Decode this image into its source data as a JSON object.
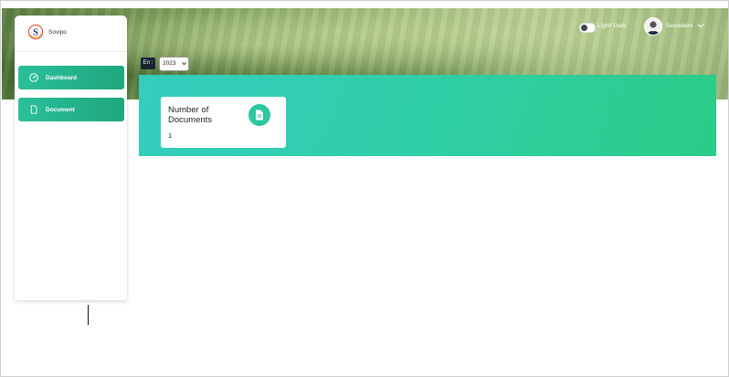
{
  "brand": {
    "name": "Sovipo",
    "logo_letter": "S"
  },
  "sidebar": {
    "items": [
      {
        "label": "Dashboard",
        "icon": "dashboard-gauge-icon",
        "active": true
      },
      {
        "label": "Document",
        "icon": "document-icon",
        "active": false
      }
    ]
  },
  "header": {
    "theme_toggle_label": "Light/ Dark",
    "user_name": "Secretaire",
    "user_avatar": "user-avatar-icon"
  },
  "filter": {
    "label": "En :",
    "year": "2023"
  },
  "stats": [
    {
      "title": "Number of Documents",
      "value": "1",
      "icon": "document-icon"
    }
  ],
  "colors": {
    "accent": "#2bbf9a",
    "banner_start": "#34cdbf",
    "banner_end": "#2ccb87"
  }
}
